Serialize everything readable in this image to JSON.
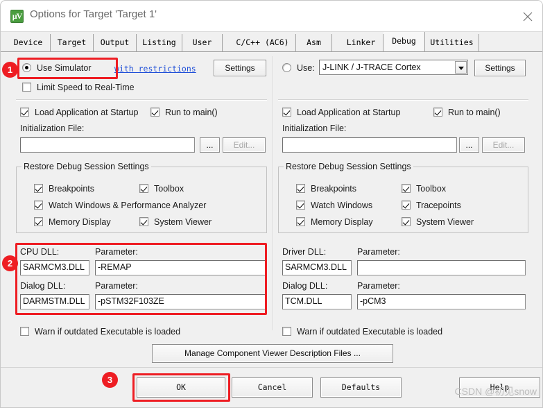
{
  "window": {
    "title": "Options for Target 'Target 1'",
    "icon": "uvision-logo-icon",
    "close_label": "×"
  },
  "tabs": [
    {
      "label": "Device",
      "active": false
    },
    {
      "label": "Target",
      "active": false
    },
    {
      "label": "Output",
      "active": false
    },
    {
      "label": "Listing",
      "active": false
    },
    {
      "label": "User",
      "active": false
    },
    {
      "label": "C/C++ (AC6)",
      "active": false
    },
    {
      "label": "Asm",
      "active": false
    },
    {
      "label": "Linker",
      "active": false
    },
    {
      "label": "Debug",
      "active": true
    },
    {
      "label": "Utilities",
      "active": false
    }
  ],
  "left": {
    "use_simulator_label": "Use Simulator",
    "use_simulator_checked": true,
    "with_restrictions_link": "with restrictions",
    "settings_button": "Settings",
    "limit_speed_label": "Limit Speed to Real-Time",
    "limit_speed_checked": false,
    "load_app_label": "Load Application at Startup",
    "load_app_checked": true,
    "run_to_main_label": "Run to main()",
    "run_to_main_checked": true,
    "init_file_label": "Initialization File:",
    "init_file_value": "",
    "browse_button": "...",
    "edit_button": "Edit...",
    "restore_group_title": "Restore Debug Session Settings",
    "restore_items": [
      {
        "label": "Breakpoints",
        "checked": true
      },
      {
        "label": "Toolbox",
        "checked": true
      },
      {
        "label": "Watch Windows & Performance Analyzer",
        "checked": true
      },
      {
        "label": "Memory Display",
        "checked": true
      },
      {
        "label": "System Viewer",
        "checked": true
      }
    ],
    "cpu_dll_label": "CPU DLL:",
    "cpu_dll_value": "SARMCM3.DLL",
    "cpu_param_label": "Parameter:",
    "cpu_param_value": "-REMAP",
    "dialog_dll_label": "Dialog DLL:",
    "dialog_dll_value": "DARMSTM.DLL",
    "dialog_param_label": "Parameter:",
    "dialog_param_value": "-pSTM32F103ZE",
    "warn_label": "Warn if outdated Executable is loaded",
    "warn_checked": false
  },
  "right": {
    "use_label": "Use:",
    "use_checked": false,
    "driver_selected": "J-LINK / J-TRACE Cortex",
    "settings_button": "Settings",
    "load_app_label": "Load Application at Startup",
    "load_app_checked": true,
    "run_to_main_label": "Run to main()",
    "run_to_main_checked": true,
    "init_file_label": "Initialization File:",
    "init_file_value": "",
    "browse_button": "...",
    "edit_button": "Edit...",
    "restore_group_title": "Restore Debug Session Settings",
    "restore_items": [
      {
        "label": "Breakpoints",
        "checked": true
      },
      {
        "label": "Toolbox",
        "checked": true
      },
      {
        "label": "Watch Windows",
        "checked": true
      },
      {
        "label": "Tracepoints",
        "checked": true
      },
      {
        "label": "Memory Display",
        "checked": true
      },
      {
        "label": "System Viewer",
        "checked": true
      }
    ],
    "driver_dll_label": "Driver DLL:",
    "driver_dll_value": "SARMCM3.DLL",
    "driver_param_label": "Parameter:",
    "driver_param_value": "",
    "dialog_dll_label": "Dialog DLL:",
    "dialog_dll_value": "TCM.DLL",
    "dialog_param_label": "Parameter:",
    "dialog_param_value": "-pCM3",
    "warn_label": "Warn if outdated Executable is loaded",
    "warn_checked": false
  },
  "manage_button": "Manage Component Viewer Description Files ...",
  "footer": {
    "ok": "OK",
    "cancel": "Cancel",
    "defaults": "Defaults",
    "help": "Help"
  },
  "annotations": {
    "badge1": "1",
    "badge2": "2",
    "badge3": "3",
    "accent": "#ee1d23"
  },
  "watermark": "CSDN @初见snow"
}
